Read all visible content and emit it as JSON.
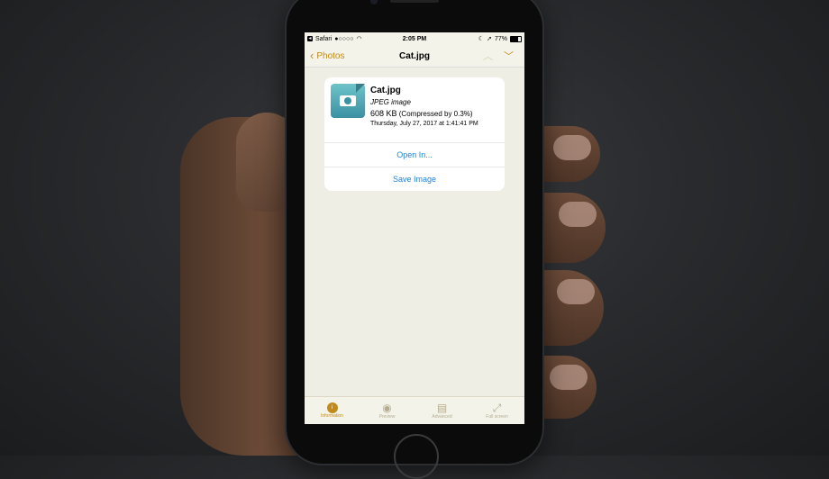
{
  "status_bar": {
    "carrier": "Safari",
    "signal": "●○○○○",
    "time": "2:05 PM",
    "battery": "77%"
  },
  "nav": {
    "back_label": "Photos",
    "title": "Cat.jpg"
  },
  "file": {
    "name": "Cat.jpg",
    "type": "JPEG image",
    "size": "608 KB",
    "compression": "(Compressed by 0.3%)",
    "date": "Thursday, July 27, 2017 at 1:41:41 PM"
  },
  "actions": {
    "open_in": "Open In...",
    "save_image": "Save Image"
  },
  "tabs": [
    {
      "label": "Information",
      "icon": "i"
    },
    {
      "label": "Preview",
      "icon": "◉"
    },
    {
      "label": "Advanced",
      "icon": "📋"
    },
    {
      "label": "Full screen",
      "icon": "⤢"
    }
  ],
  "colors": {
    "accent": "#c18a1a",
    "link": "#1f82e0",
    "screen_bg": "#efeee4"
  }
}
